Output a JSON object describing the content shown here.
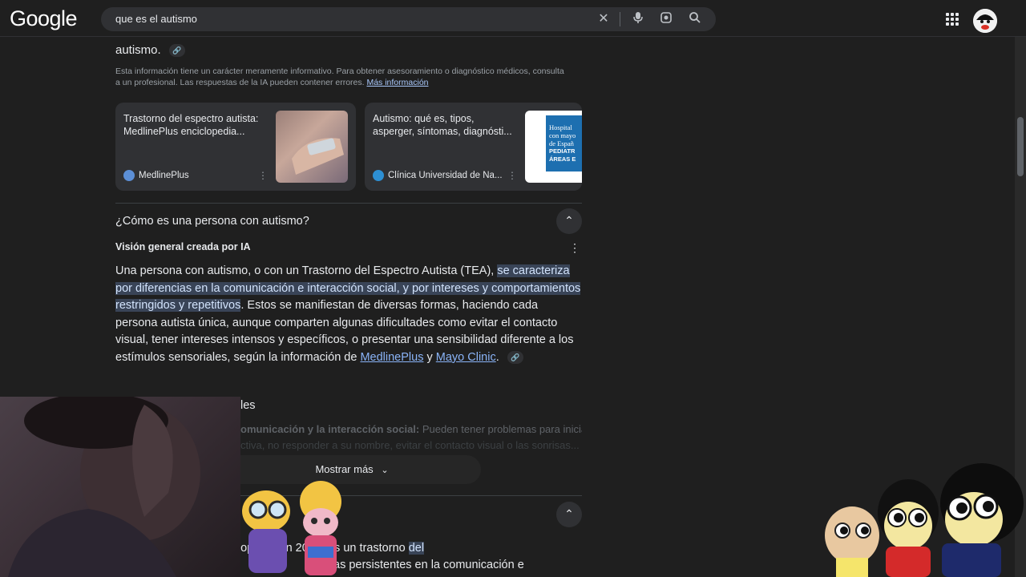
{
  "header": {
    "logo": "Google",
    "search_value": "que es el autismo"
  },
  "overview_top": {
    "tail_text": "autismo.",
    "disclaimer": "Esta información tiene un carácter meramente informativo. Para obtener asesoramiento o diagnóstico médicos, consulta a un profesional. Las respuestas de la IA pueden contener errores.",
    "more_info_link": "Más información"
  },
  "source_cards": [
    {
      "title": "Trastorno del espectro autista: MedlinePlus enciclopedia...",
      "source": "MedlinePlus"
    },
    {
      "title": "Autismo: qué es, tipos, asperger, síntomas, diagnósti...",
      "source": "Clínica Universidad de Na..."
    }
  ],
  "card2_image_text": [
    "Hospital",
    "con mayo",
    "de Españ",
    "PEDIATR",
    "ÁREAS E"
  ],
  "question_1": {
    "title": "¿Cómo es una persona con autismo?",
    "ai_label": "Visión general creada por IA",
    "body_plain_1": "Una persona con autismo, o con un Trastorno del Espectro Autista (TEA), ",
    "body_highlight": "se caracteriza por diferencias en la comunicación e interacción social, y por intereses y comportamientos restringidos y repetitivos",
    "body_plain_2": ". Estos se manifiestan de diversas formas, haciendo cada persona autista única, aunque comparten algunas dificultades como evitar el contacto visual, tener intereses intensos y específicos, o presentar una sensibilidad diferente a los estímulos sensoriales, según la información de ",
    "link_1": "MedlinePlus",
    "conj": " y ",
    "link_2": "Mayo Clinic",
    "period": "."
  },
  "faded": {
    "heading_frag": "les",
    "line_1_bold": "omunicación y la interacción social:",
    "line_1_rest": " Pueden tener problemas para iniciar o",
    "line_2": "ctiva, no responder a su nombre, evitar el contacto visual o las sonrisas..."
  },
  "show_more": "Mostrar más",
  "question_2": {
    "line_1_plain": "adoptado en 2013, es un trastorno ",
    "line_1_hl": "del",
    "line_2": "as persistentes en la comunicación e"
  }
}
